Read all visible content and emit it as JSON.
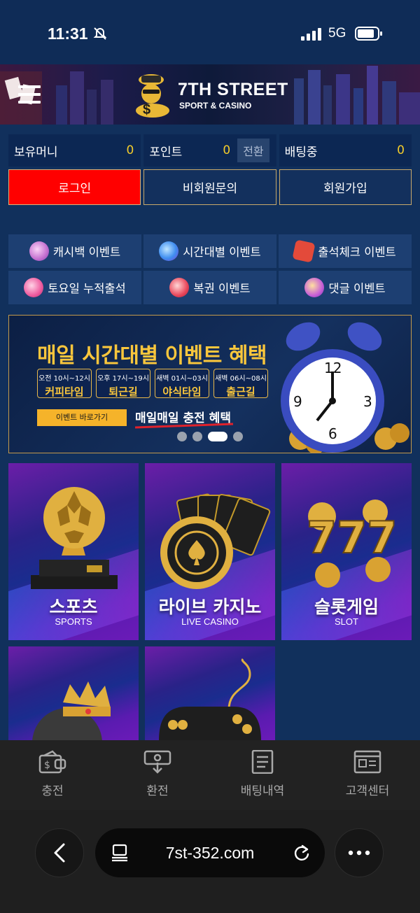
{
  "status_bar": {
    "time": "11:31",
    "network": "5G"
  },
  "header": {
    "brand_title": "7TH STREET",
    "brand_subtitle": "SPORT & CASINO"
  },
  "balance": {
    "money_label": "보유머니",
    "money_value": "0",
    "points_label": "포인트",
    "points_value": "0",
    "convert_label": "전환",
    "betting_label": "배팅중",
    "betting_value": "0"
  },
  "auth": {
    "login": "로그인",
    "guest_inquiry": "비회원문의",
    "signup": "회원가입"
  },
  "events": [
    {
      "label": "캐시백 이벤트",
      "icon": "cashback-icon",
      "color": "#d98ad6"
    },
    {
      "label": "시간대별 이벤트",
      "icon": "time-event-icon",
      "color": "#3f8ef0"
    },
    {
      "label": "출석체크 이벤트",
      "icon": "dice-icon",
      "color": "#e34a3a"
    },
    {
      "label": "토요일 누적출석",
      "icon": "candy-icon",
      "color": "#ee5a9e"
    },
    {
      "label": "복권 이벤트",
      "icon": "lottery-icon",
      "color": "#e8465a"
    },
    {
      "label": "댓글 이벤트",
      "icon": "comment-icon",
      "color": "#c75fd6"
    }
  ],
  "banner": {
    "title": "매일 시간대별 이벤트 혜택",
    "slots": [
      {
        "time": "오전 10시~12시",
        "name": "커피타임"
      },
      {
        "time": "오후 17시~19시",
        "name": "퇴근길"
      },
      {
        "time": "새벽 01시~03시",
        "name": "야식타임"
      },
      {
        "time": "새벽 06시~08시",
        "name": "출근길"
      }
    ],
    "goto_label": "이벤트 바로가기",
    "promo": "매일매일 충전 혜택",
    "clock_numbers": [
      "12",
      "3",
      "6",
      "9"
    ],
    "active_slide": 3,
    "slide_count": 4
  },
  "games": [
    {
      "name": "스포츠",
      "sub": "SPORTS",
      "icon": "soccer-trophy-icon"
    },
    {
      "name": "라이브 카지노",
      "sub": "LIVE CASINO",
      "icon": "casino-chip-icon"
    },
    {
      "name": "슬롯게임",
      "sub": "SLOT",
      "icon": "slot-777-icon"
    },
    {
      "name": "",
      "sub": "",
      "icon": "crown-chip-icon"
    },
    {
      "name": "",
      "sub": "",
      "icon": "gamepad-icon"
    }
  ],
  "bottom_nav": [
    {
      "label": "충전",
      "icon": "deposit-icon"
    },
    {
      "label": "환전",
      "icon": "withdraw-icon"
    },
    {
      "label": "배팅내역",
      "icon": "bet-history-icon"
    },
    {
      "label": "고객센터",
      "icon": "customer-center-icon"
    }
  ],
  "browser": {
    "url": "7st-352.com"
  },
  "colors": {
    "background": "#11305c",
    "accent_gold": "#f4cc2a",
    "login_red": "#ff0000",
    "nav_bg": "#222222"
  }
}
